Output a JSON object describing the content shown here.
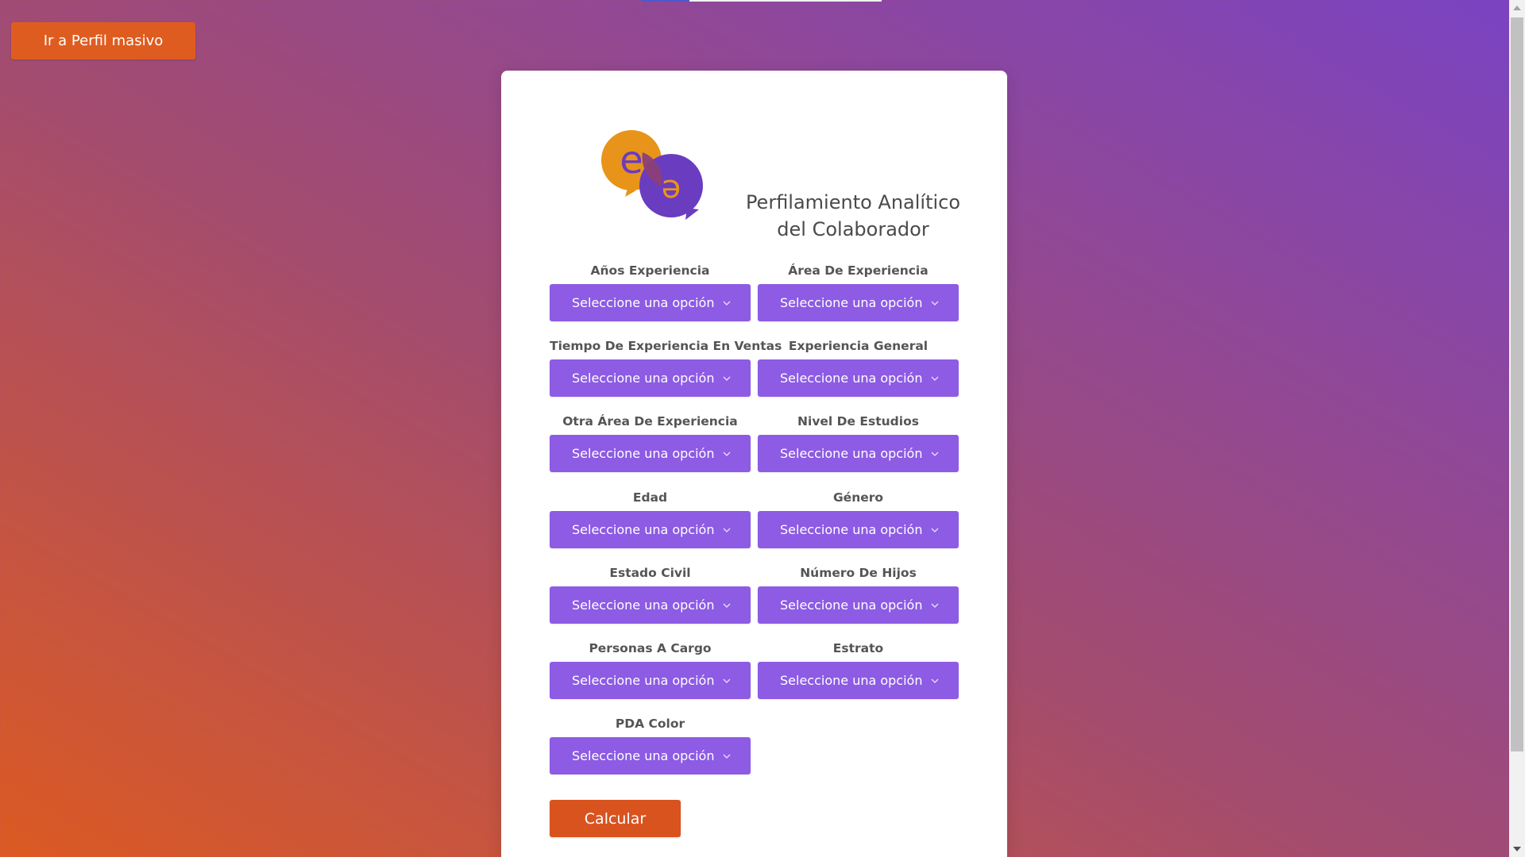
{
  "header": {
    "mass_profile_button_label": "Ir a Perfil masivo"
  },
  "card": {
    "title_line_1": "Perfilamiento Analítico",
    "title_line_2": "del Colaborador",
    "logo": {
      "icon": "dual-speech-bubble-logo",
      "letter_1": "e",
      "letter_2": "e"
    },
    "fields": [
      {
        "label": "Años Experiencia",
        "selected": "Seleccione una opción"
      },
      {
        "label": "Área De Experiencia",
        "selected": "Seleccione una opción"
      },
      {
        "label": "Tiempo De Experiencia En Ventas",
        "selected": "Seleccione una opción"
      },
      {
        "label": "Experiencia General",
        "selected": "Seleccione una opción"
      },
      {
        "label": "Otra Área De Experiencia",
        "selected": "Seleccione una opción"
      },
      {
        "label": "Nivel De Estudios",
        "selected": "Seleccione una opción"
      },
      {
        "label": "Edad",
        "selected": "Seleccione una opción"
      },
      {
        "label": "Género",
        "selected": "Seleccione una opción"
      },
      {
        "label": "Estado Civil",
        "selected": "Seleccione una opción"
      },
      {
        "label": "Número De Hijos",
        "selected": "Seleccione una opción"
      },
      {
        "label": "Personas A Cargo",
        "selected": "Seleccione una opción"
      },
      {
        "label": "Estrato",
        "selected": "Seleccione una opción"
      },
      {
        "label": "PDA Color",
        "selected": "Seleccione una opción"
      }
    ],
    "calculate_button_label": "Calcular"
  },
  "colors": {
    "background_start": "#dc5a22",
    "background_mid": "#a44c6e",
    "background_end": "#7a43c3",
    "primary_select": "#8d5be4",
    "accent_button": "#df5c20",
    "card_bg": "#ffffff",
    "logo_orange": "#e8941a",
    "logo_purple": "#6a3cc0"
  }
}
